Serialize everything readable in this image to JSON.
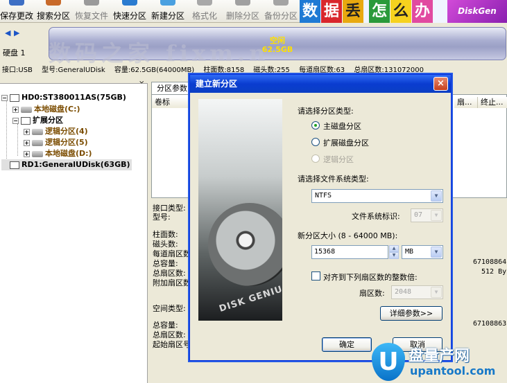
{
  "toolbar": {
    "buttons": [
      {
        "label": "保存更改",
        "enabled": true,
        "icon": "save-icon"
      },
      {
        "label": "搜索分区",
        "enabled": true,
        "icon": "search-icon"
      },
      {
        "label": "恢复文件",
        "enabled": false,
        "icon": "restore-icon"
      },
      {
        "label": "快速分区",
        "enabled": true,
        "icon": "quick-partition-icon"
      },
      {
        "label": "新建分区",
        "enabled": true,
        "icon": "new-partition-icon"
      },
      {
        "label": "格式化",
        "enabled": false,
        "icon": "format-icon"
      },
      {
        "label": "删除分区",
        "enabled": false,
        "icon": "delete-icon"
      },
      {
        "label": "备份分区",
        "enabled": false,
        "icon": "backup-icon"
      }
    ],
    "banner_chars": [
      "数",
      "据",
      "丢",
      "怎",
      "么",
      "办"
    ],
    "brand": "DiskGen"
  },
  "diskbar": {
    "disk_label": "硬盘 1",
    "partition_name": "空闲",
    "partition_size": "62.5GB",
    "watermark": "数码之家 fixm.n"
  },
  "infostrip": {
    "interface": "接口:USB",
    "model": "型号:GeneralUDisk",
    "capacity": "容量:62.5GB(64000MB)",
    "cylinders": "柱面数:8158",
    "heads": "磁头数:255",
    "sectors_per_track": "每道扇区数:63",
    "total_sectors": "总扇区数:131072000"
  },
  "tree": {
    "close": "×",
    "nodes": [
      {
        "label": "HD0:ST380011AS(75GB)",
        "kind": "disk"
      },
      {
        "label": "本地磁盘(C:)",
        "kind": "part"
      },
      {
        "label": "扩展分区",
        "kind": "ext"
      },
      {
        "label": "逻辑分区(4)",
        "kind": "part"
      },
      {
        "label": "逻辑分区(5)",
        "kind": "part"
      },
      {
        "label": "本地磁盘(D:)",
        "kind": "part"
      },
      {
        "label": "RD1:GeneralUDisk(63GB)",
        "kind": "disk"
      }
    ]
  },
  "rightpanel": {
    "tab": "分区参数",
    "columns": [
      "卷标",
      "扇...",
      "终止..."
    ],
    "props_top": [
      "接口类型:",
      "型号:",
      "柱面数:",
      "磁头数:",
      "每道扇区数:",
      "总容量:",
      "总扇区数:",
      "附加扇区数:"
    ],
    "props_bottom": [
      "空间类型:",
      "总容量:",
      "总扇区数:",
      "起始扇区号:"
    ],
    "values": [
      "67108864",
      "512 By",
      "67108863"
    ]
  },
  "dialog": {
    "title": "建立新分区",
    "close": "×",
    "image_caption": "DISK GENIUS",
    "type_label": "请选择分区类型:",
    "options": [
      {
        "label": "主磁盘分区",
        "checked": true,
        "enabled": true
      },
      {
        "label": "扩展磁盘分区",
        "checked": false,
        "enabled": true
      },
      {
        "label": "逻辑分区",
        "checked": false,
        "enabled": false
      }
    ],
    "fs_label": "请选择文件系统类型:",
    "fs_value": "NTFS",
    "fs_id_label": "文件系统标识:",
    "fs_id_value": "07",
    "size_label": "新分区大小 (8 - 64000 MB):",
    "size_value": "15368",
    "unit_value": "MB",
    "align_label": "对齐到下列扇区数的整数倍:",
    "sectors_label": "扇区数:",
    "sectors_value": "2048",
    "details_button": "详细参数>>",
    "ok_button": "确定",
    "cancel_button": "取消"
  },
  "logo": {
    "letter": "U",
    "cn": "盘量产网",
    "url": "upantool.com"
  }
}
